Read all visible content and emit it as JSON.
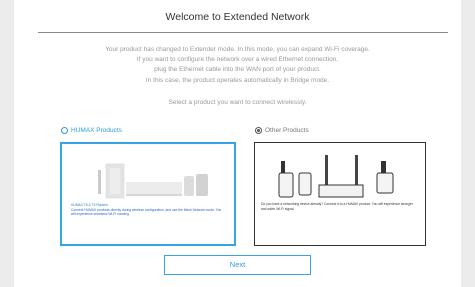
{
  "header": {
    "title": "Welcome to Extended Network"
  },
  "description": [
    "Your product has changed to Extender mode. In this mode, you can expand Wi-Fi coverage.",
    "If you want to configure the network over a wired Ethernet connection,",
    "plug the Ethernet cable into the WAN port of your product.",
    "In this case, the product operates automatically in Bridge mode."
  ],
  "prompt": "Select a product you want to connect wirelessly.",
  "options": {
    "humax": {
      "label": "HUMAX Products",
      "selected": false,
      "card_heading": "HUMAX T8 & T5 Routers",
      "card_text": "Connect HUMAX products directly during wireless configuration, and use the Mesh Network mode. You will experience seamless Wi-Fi roaming."
    },
    "other": {
      "label": "Other Products",
      "selected": true,
      "card_text": "Do you have a networking device already? Connect it to a HUMAX product. You will experience stronger and wider Wi-Fi signal."
    }
  },
  "footer": {
    "next_label": "Next"
  },
  "colors": {
    "accent": "#2e9be4",
    "text_muted": "#9a9a9a",
    "title": "#333333"
  }
}
